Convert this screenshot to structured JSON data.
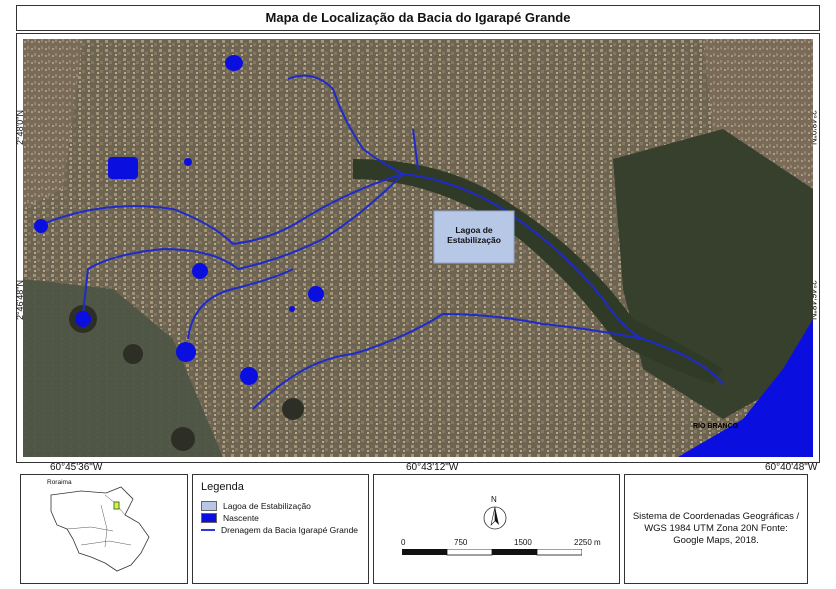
{
  "title": "Mapa de Localização da Bacia do Igarapé Grande",
  "coordinates": {
    "lat_top": "2°48'0\"N",
    "lat_bottom": "2°46'48\"N",
    "lon_left": "60°45'36\"W",
    "lon_center": "60°43'12\"W",
    "lon_right": "60°40'48\"W"
  },
  "map_labels": {
    "lagoon": "Lagoa de Estabilização",
    "river": "RIO BRANCO"
  },
  "colors": {
    "lagoon": "#b7c7e6",
    "nascente": "#0a0fe0",
    "drainage": "#1f2bc9",
    "river": "#0a0fe0"
  },
  "legend": {
    "title": "Legenda",
    "items": [
      {
        "label": "Lagoa de Estabilização",
        "type": "fill",
        "color": "#b7c7e6"
      },
      {
        "label": "Nascente",
        "type": "fill",
        "color": "#0a0fe0"
      },
      {
        "label": "Drenagem da Bacia Igarapé Grande",
        "type": "line",
        "color": "#2a3bd8"
      }
    ]
  },
  "locator": {
    "label": "Roraima"
  },
  "north_arrow": "N",
  "scale_bar": {
    "labels": [
      "0",
      "750",
      "1500",
      "2250 m"
    ]
  },
  "crs_text": "Sistema de Coordenadas Geográficas / WGS 1984 UTM Zona 20N Fonte: Google Maps, 2018."
}
